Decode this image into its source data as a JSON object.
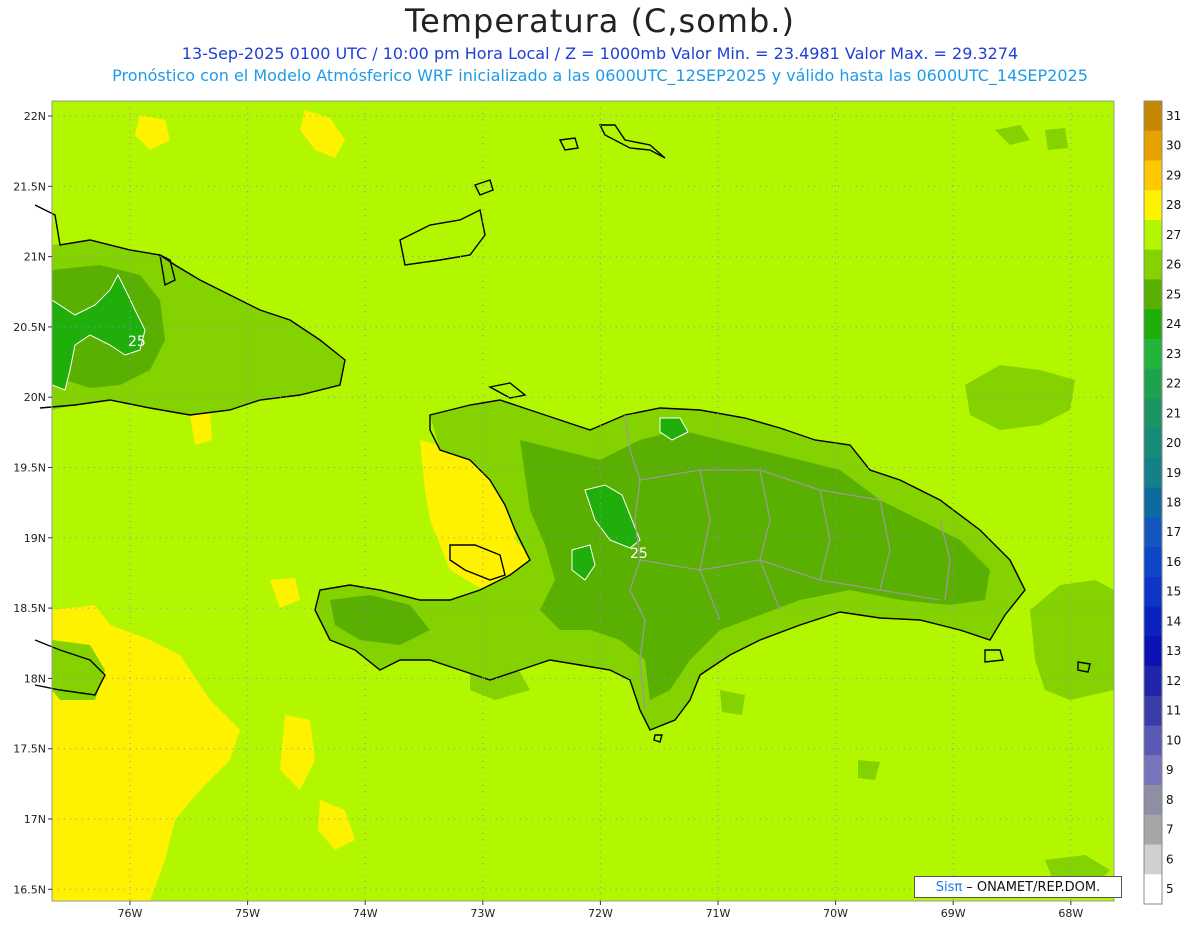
{
  "title": "Temperatura (C,somb.)",
  "subtitle1": "13-Sep-2025 0100 UTC / 10:00 pm Hora Local / Z = 1000mb   Valor Min. = 23.4981   Valor Max. = 29.3274",
  "subtitle2": "Pronóstico con el Modelo Atmósferico WRF inicializado a las 0600UTC_12SEP2025 y válido hasta las  0600UTC_14SEP2025",
  "map": {
    "lat_ticks": [
      "22N",
      "21.5N",
      "21N",
      "20.5N",
      "20N",
      "19.5N",
      "19N",
      "18.5N",
      "18N",
      "17.5N",
      "17N",
      "16.5N"
    ],
    "lon_ticks": [
      "76W",
      "75W",
      "74W",
      "73W",
      "72W",
      "71W",
      "70W",
      "69W",
      "68W"
    ],
    "contour_labels": [
      "25",
      "25"
    ],
    "background_color": "#b2f700"
  },
  "colorbar": {
    "levels": [
      "31",
      "30",
      "29",
      "28",
      "27",
      "26",
      "25",
      "24",
      "23",
      "22",
      "21",
      "20",
      "19",
      "18",
      "17",
      "16",
      "15",
      "14",
      "13",
      "12",
      "11",
      "10",
      "9",
      "8",
      "7",
      "6",
      "5"
    ],
    "colors": [
      "#c58600",
      "#e8a200",
      "#ffc800",
      "#fff200",
      "#b2f700",
      "#84d200",
      "#5ab000",
      "#1fae0a",
      "#23b43c",
      "#1fa24d",
      "#1d9464",
      "#178a78",
      "#13808a",
      "#0f6aa0",
      "#1256be",
      "#0f46c8",
      "#0d36c8",
      "#0a22c0",
      "#0a12b4",
      "#1f24a8",
      "#3a3ca8",
      "#5a5ab4",
      "#7a74bc",
      "#8f8fa4",
      "#a6a6a6",
      "#d0d0d0",
      "#ffffff"
    ]
  },
  "credit": {
    "brand": "Sisπ",
    "text": "– ONAMET/REP.DOM."
  }
}
